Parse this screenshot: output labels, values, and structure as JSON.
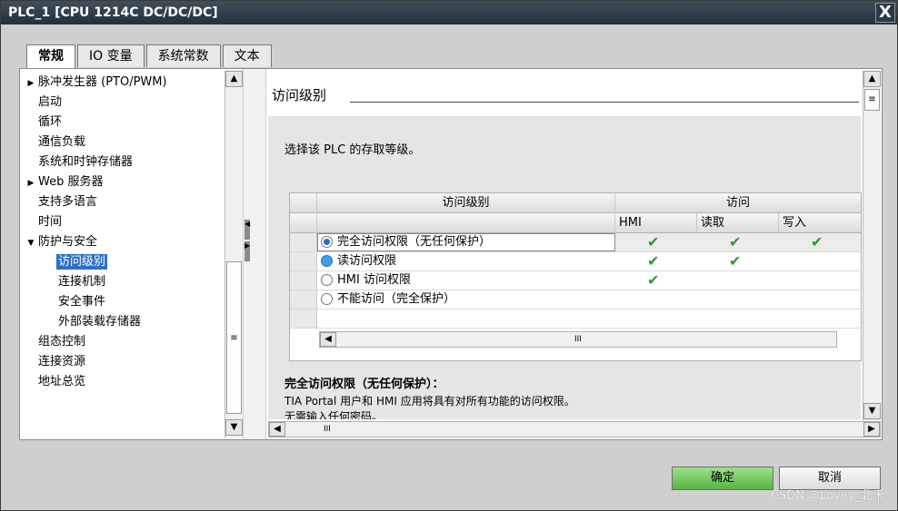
{
  "window": {
    "title": "PLC_1 [CPU 1214C DC/DC/DC]",
    "close_glyph": "X"
  },
  "tabs": [
    {
      "label": "常规",
      "active": true
    },
    {
      "label": "IO 变量",
      "active": false
    },
    {
      "label": "系统常数",
      "active": false
    },
    {
      "label": "文本",
      "active": false
    }
  ],
  "tree": {
    "items": [
      {
        "label": "脉冲发生器 (PTO/PWM)",
        "expander": "▶"
      },
      {
        "label": "启动",
        "expander": ""
      },
      {
        "label": "循环",
        "expander": ""
      },
      {
        "label": "通信负载",
        "expander": ""
      },
      {
        "label": "系统和时钟存储器",
        "expander": ""
      },
      {
        "label": "Web 服务器",
        "expander": "▶"
      },
      {
        "label": "支持多语言",
        "expander": ""
      },
      {
        "label": "时间",
        "expander": ""
      },
      {
        "label": "防护与安全",
        "expander": "▼"
      },
      {
        "label": "访问级别",
        "expander": "",
        "selected": true
      },
      {
        "label": "连接机制",
        "expander": ""
      },
      {
        "label": "安全事件",
        "expander": ""
      },
      {
        "label": "外部装载存储器",
        "expander": ""
      },
      {
        "label": "组态控制",
        "expander": ""
      },
      {
        "label": "连接资源",
        "expander": ""
      },
      {
        "label": "地址总览",
        "expander": ""
      }
    ]
  },
  "section": {
    "title": "访问级别",
    "description": "选择该 PLC 的存取等级。"
  },
  "grid": {
    "header_access_level": "访问级别",
    "header_access": "访问",
    "header_hmi": "HMI",
    "header_read": "读取",
    "header_write": "写入",
    "rows": [
      {
        "label": "完全访问权限（无任何保护）",
        "hmi": "✔",
        "read": "✔",
        "write": "✔",
        "state": "checked"
      },
      {
        "label": "读访问权限",
        "hmi": "✔",
        "read": "✔",
        "write": "",
        "state": "hover"
      },
      {
        "label": "HMI 访问权限",
        "hmi": "✔",
        "read": "",
        "write": "",
        "state": "none"
      },
      {
        "label": "不能访问（完全保护）",
        "hmi": "",
        "read": "",
        "write": "",
        "state": "none"
      }
    ]
  },
  "detail": {
    "title": "完全访问权限（无任何保护）：",
    "text": "TIA Portal 用户和 HMI 应用将具有对所有功能的访问权限。",
    "text2": "无需输入任何密码。"
  },
  "buttons": {
    "ok": "确定",
    "cancel": "取消"
  },
  "scroll_glyphs": {
    "up": "▲",
    "down": "▼",
    "left": "◀",
    "right": "▶",
    "grip": "≡",
    "hgrip": "III"
  },
  "watermark": "CSDN @Lovey_北禾"
}
